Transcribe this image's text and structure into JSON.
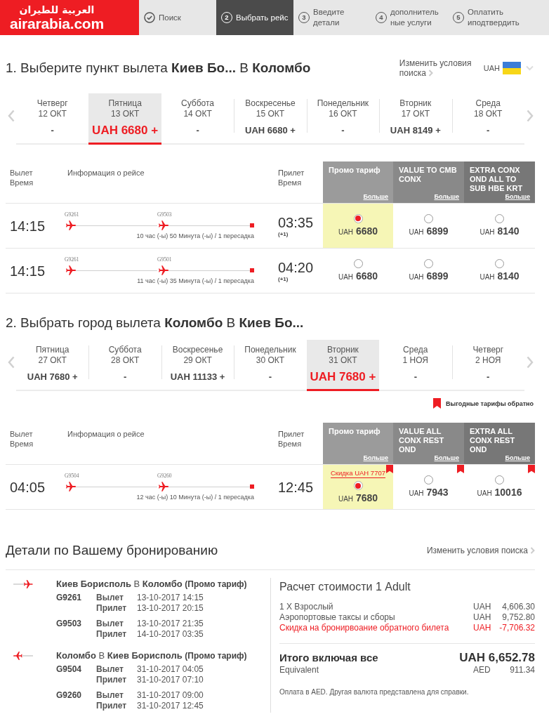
{
  "header": {
    "logo": {
      "arabic": "العربية للطيران",
      "latin": "airarabia.com"
    },
    "steps": [
      {
        "kind": "done",
        "label": "Поиск",
        "selected": false
      },
      {
        "kind": "number",
        "number": "2",
        "label": "Выбрать рейс",
        "selected": true
      },
      {
        "kind": "number",
        "number": "3",
        "label": "Введите детали",
        "selected": false
      },
      {
        "kind": "number",
        "number": "4",
        "label": "дополнительные услуги",
        "selected": false
      },
      {
        "kind": "number",
        "number": "5",
        "label": "Оплатить иподтвердить",
        "selected": false
      }
    ]
  },
  "sections": [
    {
      "title": "1. Выберите пункт вылета **Киев Бо...** В **Коломбо**",
      "change_link": "Изменить условия поиска",
      "currency": "UAH",
      "dates": [
        {
          "day": "Четверг",
          "date": "12 ОКТ",
          "price": "-",
          "selected": false
        },
        {
          "day": "Пятница",
          "date": "13 ОКТ",
          "price": "UAH 6680 +",
          "selected": true
        },
        {
          "day": "Суббота",
          "date": "14 ОКТ",
          "price": "-",
          "selected": false
        },
        {
          "day": "Воскресенье",
          "date": "15 ОКТ",
          "price": "UAH 6680 +",
          "selected": false
        },
        {
          "day": "Понедельник",
          "date": "16 ОКТ",
          "price": "-",
          "selected": false
        },
        {
          "day": "Вторник",
          "date": "17 ОКТ",
          "price": "UAH 8149 +",
          "selected": false
        },
        {
          "day": "Среда",
          "date": "18 ОКТ",
          "price": "-",
          "selected": false
        }
      ],
      "columns": {
        "departure": "Вылет Время",
        "info": "Информация о рейсе",
        "arrival": "Прилет Время"
      },
      "fare_classes": [
        {
          "name": "Промо тариф",
          "more": "Больше"
        },
        {
          "name": "VALUE TO CMB CONX",
          "more": "Больше"
        },
        {
          "name": "EXTRA CONX OND ALL TO SUB HBE KRT",
          "more": "Больше"
        }
      ],
      "flights": [
        {
          "departure": "14:15",
          "segments": [
            "G9261",
            "G9503"
          ],
          "duration": "10 час (-ы) 50 Минута (-ы) / 1 пересадка",
          "arrival": "03:35",
          "next_day": "(+1)",
          "fares": [
            {
              "currency": "UAH",
              "price": "6680",
              "selected": true,
              "flagged": false
            },
            {
              "currency": "UAH",
              "price": "6899",
              "selected": false,
              "flagged": false
            },
            {
              "currency": "UAH",
              "price": "8140",
              "selected": false,
              "flagged": false
            }
          ]
        },
        {
          "departure": "14:15",
          "segments": [
            "G9261",
            "G9501"
          ],
          "duration": "11 час (-ы) 35 Минута (-ы) / 1 пересадка",
          "arrival": "04:20",
          "next_day": "(+1)",
          "fares": [
            {
              "currency": "UAH",
              "price": "6680",
              "selected": false,
              "flagged": false
            },
            {
              "currency": "UAH",
              "price": "6899",
              "selected": false,
              "flagged": false
            },
            {
              "currency": "UAH",
              "price": "8140",
              "selected": false,
              "flagged": false
            }
          ]
        }
      ]
    },
    {
      "title": "2. Выбрать город вылета **Коломбо** В **Киев Бо...**",
      "dates": [
        {
          "day": "Пятница",
          "date": "27 ОКТ",
          "price": "UAH 7680 +",
          "selected": false
        },
        {
          "day": "Суббота",
          "date": "28 ОКТ",
          "price": "-",
          "selected": false
        },
        {
          "day": "Воскресенье",
          "date": "29 ОКТ",
          "price": "UAH 11133 +",
          "selected": false
        },
        {
          "day": "Понедельник",
          "date": "30 ОКТ",
          "price": "-",
          "selected": false
        },
        {
          "day": "Вторник",
          "date": "31 ОКТ",
          "price": "UAH 7680 +",
          "selected": true
        },
        {
          "day": "Среда",
          "date": "1 НОЯ",
          "price": "-",
          "selected": false
        },
        {
          "day": "Четверг",
          "date": "2 НОЯ",
          "price": "-",
          "selected": false
        }
      ],
      "legend": "Выгодные тарифы обратно",
      "columns": {
        "departure": "Вылет Время",
        "info": "Информация о рейсе",
        "arrival": "Прилет Время"
      },
      "fare_classes": [
        {
          "name": "Промо тариф",
          "more": "Больше"
        },
        {
          "name": "VALUE ALL CONX REST OND",
          "more": "Больше"
        },
        {
          "name": "EXTRA ALL CONX REST OND",
          "more": "Больше"
        }
      ],
      "flights": [
        {
          "departure": "04:05",
          "segments": [
            "G9504",
            "G9260"
          ],
          "duration": "12 час (-ы) 10 Минута (-ы) / 1 пересадка",
          "arrival": "12:45",
          "fares": [
            {
              "discount": "Скидка UAH 7707",
              "currency": "UAH",
              "price": "7680",
              "selected": true,
              "flagged": true
            },
            {
              "currency": "UAH",
              "price": "7943",
              "selected": false,
              "flagged": true
            },
            {
              "currency": "UAH",
              "price": "10016",
              "selected": false,
              "flagged": true
            }
          ]
        }
      ]
    }
  ],
  "booking": {
    "title": "Детали по Вашему бронированию",
    "change_link": "Изменить условия поиска",
    "journeys": [
      {
        "kind": "outbound",
        "route": "**Киев Борисполь** В **Коломбо**",
        "fare": "(Промо тариф)",
        "segments": [
          {
            "flight": "G9261",
            "legs": [
              {
                "label": "Вылет",
                "time": "13-10-2017 14:15"
              },
              {
                "label": "Прилет",
                "time": "13-10-2017 20:15"
              }
            ]
          },
          {
            "flight": "G9503",
            "legs": [
              {
                "label": "Вылет",
                "time": "13-10-2017 21:35"
              },
              {
                "label": "Прилет",
                "time": "14-10-2017 03:35"
              }
            ]
          }
        ]
      },
      {
        "kind": "return",
        "route": "**Коломбо** В **Киев Борисполь**",
        "fare": "(Промо тариф)",
        "segments": [
          {
            "flight": "G9504",
            "legs": [
              {
                "label": "Вылет",
                "time": "31-10-2017 04:05"
              },
              {
                "label": "Прилет",
                "time": "31-10-2017 07:10"
              }
            ]
          },
          {
            "flight": "G9260",
            "legs": [
              {
                "label": "Вылет",
                "time": "31-10-2017 09:00"
              },
              {
                "label": "Прилет",
                "time": "31-10-2017 12:45"
              }
            ]
          }
        ]
      }
    ],
    "pricing": {
      "title": "Расчет стоимости 1 Adult",
      "lines": [
        {
          "kind": "charge",
          "label": "1 X Взрослый",
          "currency": "UAH",
          "amount": "4,606.30"
        },
        {
          "kind": "charge",
          "label": "Аэропортовые таксы и сборы",
          "currency": "UAH",
          "amount": "9,752.80"
        },
        {
          "kind": "discount",
          "label": "Скидка на бронирвоание обратного билета",
          "currency": "UAH",
          "amount": "-7,706.32"
        }
      ],
      "total": {
        "label": "Итого включая все",
        "value": "UAH 6,652.78"
      },
      "equivalent": {
        "label": "Equivalent",
        "currency": "AED",
        "amount": "911.34"
      },
      "note": "Оплата в AED. Другая валюта представлена для справки."
    }
  }
}
